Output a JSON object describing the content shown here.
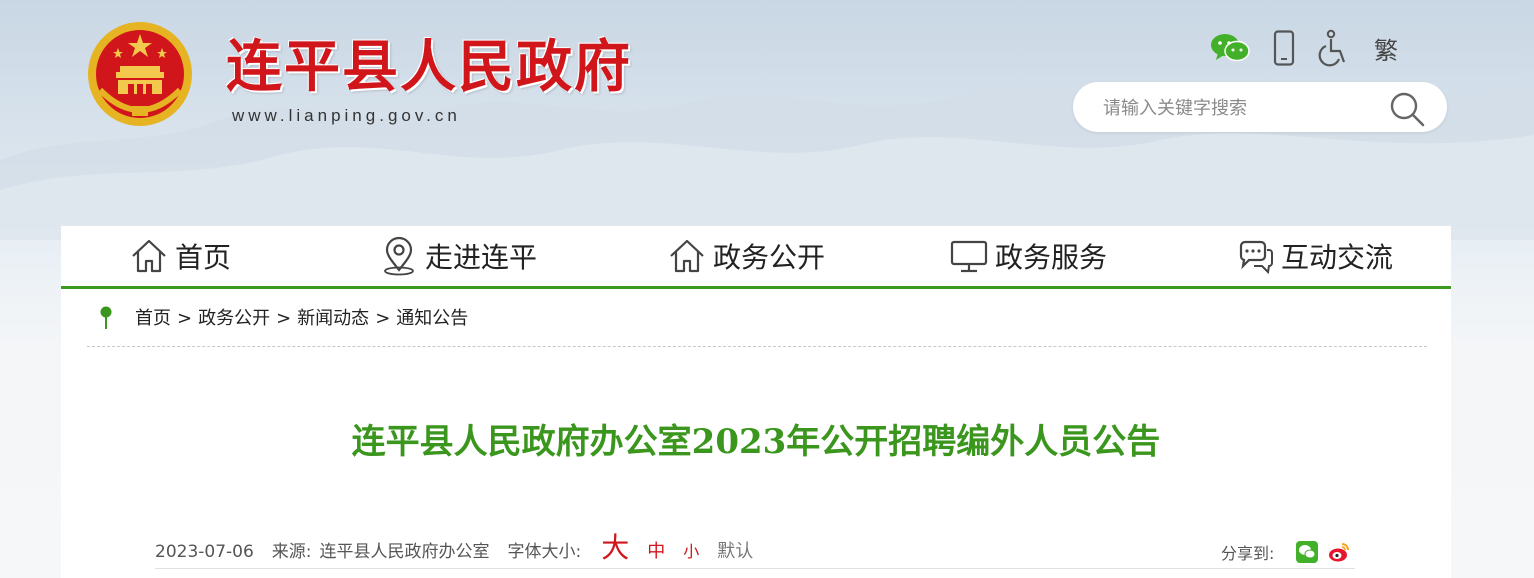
{
  "header": {
    "site_title": "连平县人民政府",
    "site_url": "www.lianping.gov.cn",
    "tools": [
      {
        "name": "wechat-icon"
      },
      {
        "name": "mobile-icon"
      },
      {
        "name": "accessibility-icon"
      },
      {
        "name": "traditional-chinese",
        "label": "繁"
      }
    ],
    "search": {
      "placeholder": "请输入关键字搜索",
      "icon": "search-icon"
    }
  },
  "nav": {
    "items": [
      {
        "label": "首页",
        "icon": "home-icon"
      },
      {
        "label": "走进连平",
        "icon": "location-icon"
      },
      {
        "label": "政务公开",
        "icon": "home-icon"
      },
      {
        "label": "政务服务",
        "icon": "monitor-icon"
      },
      {
        "label": "互动交流",
        "icon": "chat-icon"
      }
    ]
  },
  "breadcrumb": {
    "items": [
      "首页",
      "政务公开",
      "新闻动态",
      "通知公告"
    ],
    "separator": ">"
  },
  "article": {
    "title": "连平县人民政府办公室2023年公开招聘编外人员公告",
    "date": "2023-07-06",
    "source_label": "来源:",
    "source": "连平县人民政府办公室",
    "font_size_label": "字体大小:",
    "font_sizes": {
      "large": "大",
      "medium": "中",
      "small": "小",
      "default": "默认"
    },
    "share_label": "分享到:"
  },
  "colors": {
    "brand_red": "#d0161b",
    "brand_green": "#3a961c",
    "nav_border": "#3c9a20"
  }
}
